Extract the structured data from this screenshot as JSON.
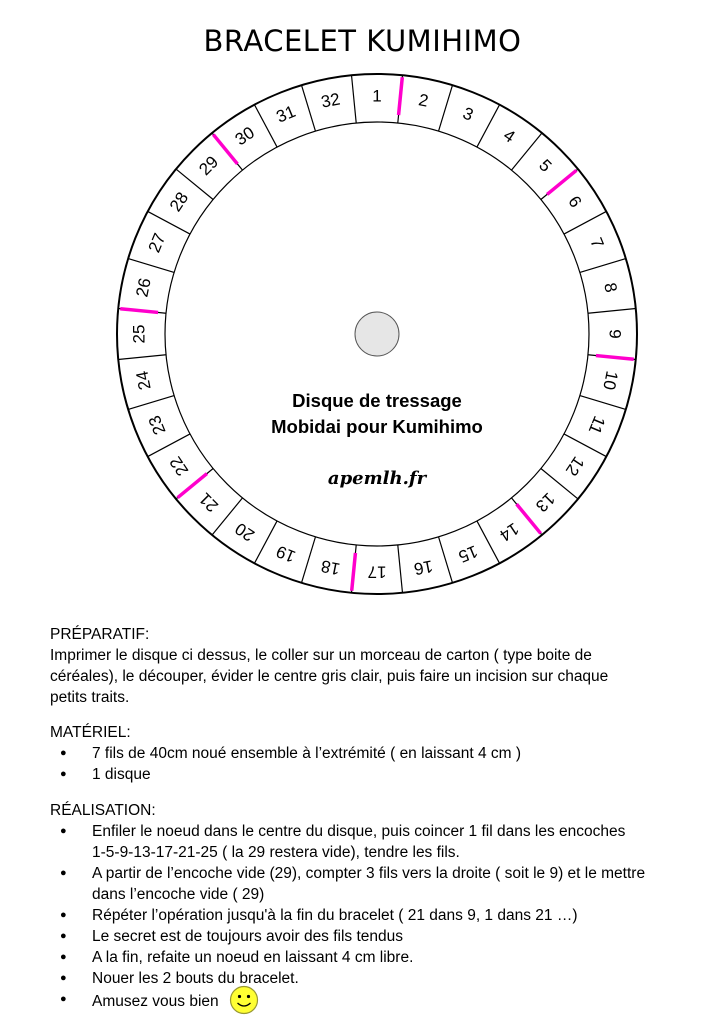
{
  "title": "BRACELET KUMIHIMO",
  "disc": {
    "slots": [
      "1",
      "2",
      "3",
      "4",
      "5",
      "6",
      "7",
      "8",
      "9",
      "10",
      "11",
      "12",
      "13",
      "14",
      "15",
      "16",
      "17",
      "18",
      "19",
      "20",
      "21",
      "22",
      "23",
      "24",
      "25",
      "26",
      "27",
      "28",
      "29",
      "30",
      "31",
      "32"
    ],
    "marked_notches": [
      1,
      5,
      9,
      13,
      17,
      21,
      25,
      29
    ],
    "mark_color": "#ff00cc",
    "center_hole_color": "#e6e6e6",
    "caption_line1": "Disque de tressage",
    "caption_line2": "Mobidai pour Kumihimo",
    "site": "apemlh.fr"
  },
  "prep": {
    "heading": "PRÉPARATIF:",
    "text_lines": [
      " Imprimer le disque ci dessus, le coller sur un morceau de carton ( type boite de",
      "céréales), le découper, évider le centre gris clair, puis faire un incision sur chaque",
      "petits traits."
    ]
  },
  "materiel": {
    "heading": "MATÉRIEL:",
    "items": [
      "7 fils de 40cm noué ensemble à l’extrémité ( en laissant 4 cm )",
      "1 disque"
    ]
  },
  "realisation": {
    "heading": "RÉALISATION:",
    "items": [
      [
        "Enfiler le noeud dans le centre du disque, puis coincer 1 fil dans les encoches",
        "1-5-9-13-17-21-25 ( la 29 restera vide), tendre les fils."
      ],
      [
        "A partir de l’encoche vide (29), compter 3 fils vers la droite ( soit le 9) et le mettre",
        "dans l’encoche vide ( 29)"
      ],
      [
        "Répéter l’opération jusqu'à la fin du bracelet ( 21 dans 9, 1 dans 21 …)"
      ],
      [
        "Le secret est de toujours avoir des fils tendus"
      ],
      [
        "A la fin, refaite un noeud en laissant 4 cm libre."
      ],
      [
        "Nouer les 2 bouts du bracelet."
      ],
      [
        "Amusez vous bien"
      ]
    ]
  },
  "colors": {
    "smiley_fill": "#ffff33",
    "smiley_stroke": "#999933"
  }
}
